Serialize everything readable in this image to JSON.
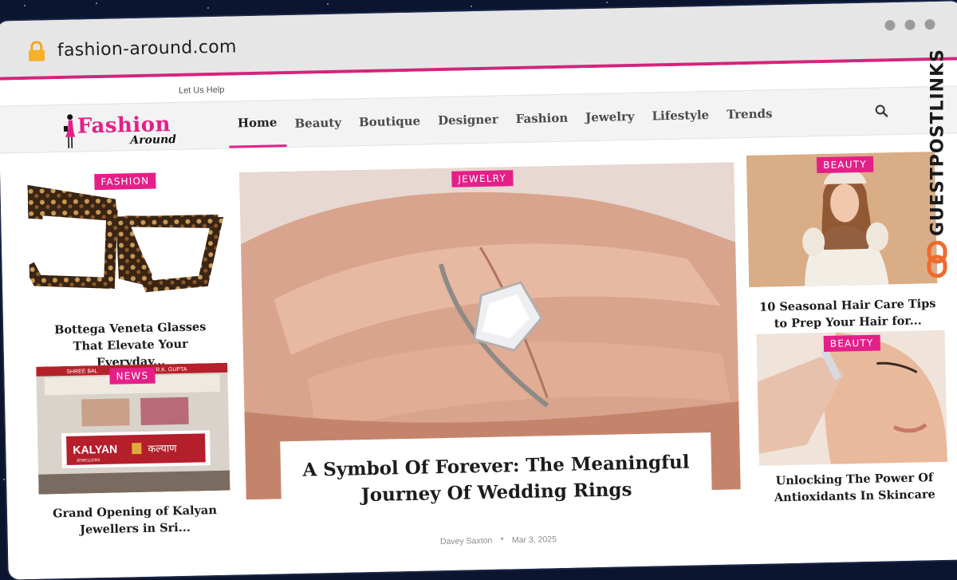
{
  "browser": {
    "url": "fashion-around.com"
  },
  "topbar": {
    "help_link": "Let Us Help"
  },
  "logo": {
    "line1": "Fashion",
    "line2": "Around"
  },
  "nav": {
    "items": [
      {
        "label": "Home",
        "active": true
      },
      {
        "label": "Beauty"
      },
      {
        "label": "Boutique"
      },
      {
        "label": "Designer"
      },
      {
        "label": "Fashion"
      },
      {
        "label": "Jewelry"
      },
      {
        "label": "Lifestyle"
      },
      {
        "label": "Trends"
      }
    ]
  },
  "left": [
    {
      "tag": "FASHION",
      "title": "Bottega Veneta Glasses That Elevate Your Everyday..."
    },
    {
      "tag": "NEWS",
      "title": "Grand Opening of Kalyan Jewellers in Sri...",
      "sign_brand": "KALYAN",
      "sign_sub": "JEWELLERS",
      "sign_hindi": "कल्याण",
      "sign_top_left": "SHREE BAL",
      "sign_top_right": "R.K. GUPTA"
    }
  ],
  "hero": {
    "tag": "JEWELRY",
    "title": "A Symbol Of Forever: The Meaningful Journey Of Wedding Rings",
    "author": "Davey Saxton",
    "date": "Mar 3, 2025"
  },
  "right": [
    {
      "tag": "BEAUTY",
      "title": "10 Seasonal Hair Care Tips to Prep Your Hair for..."
    },
    {
      "tag": "BEAUTY",
      "title": "Unlocking The Power Of Antioxidants In Skincare"
    }
  ],
  "watermark": {
    "text": "GUESTPOSTLINKS"
  },
  "colors": {
    "accent": "#e51f88",
    "chrome": "#e6e6e6",
    "background": "#0b1530"
  }
}
